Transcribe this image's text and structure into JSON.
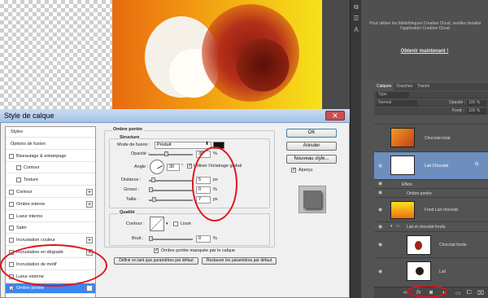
{
  "colors": {
    "accent_red": "#e0141e",
    "selection": "#3d86f0",
    "layer_selected": "#6d8fbf",
    "shadow_swatch": "#111111"
  },
  "cc": {
    "message": "Pour utiliser les bibliothèques Creative Cloud, veuillez installer l'application Creative Cloud.",
    "link": "Obtenir maintenant !"
  },
  "panel": {
    "tabs": [
      "Calques",
      "Couches",
      "Tracés"
    ],
    "filter": "Type",
    "blend": "Normal",
    "opacity_label": "Opacité :",
    "opacity": "100 %",
    "fill_label": "Fond :",
    "fill": "100 %",
    "layers": [
      {
        "name": "Chocolat éclat"
      },
      {
        "name": "Lait Chocolat",
        "fx": "fx"
      },
      {
        "name": "Effets"
      },
      {
        "name": "Ombre portée"
      },
      {
        "name": "Fond Lait chocolat"
      },
      {
        "name": "Lait et chocolat fondu"
      },
      {
        "name": "Chocolat fondu"
      },
      {
        "name": "Lait"
      }
    ],
    "bottom_icons": [
      "link-icon",
      "fx-icon",
      "mask-icon",
      "adjustment-icon",
      "folder-icon",
      "new-layer-icon",
      "trash-icon"
    ]
  },
  "dialog": {
    "title": "Style de calque",
    "close": "✕",
    "styles_list": [
      {
        "label": "Styles",
        "checkbox": false
      },
      {
        "label": "Options de fusion",
        "checkbox": false
      },
      {
        "label": "Biseautage & estampage",
        "checkbox": true,
        "checked": false
      },
      {
        "label": "Contour",
        "checkbox": true,
        "checked": false,
        "sub": true
      },
      {
        "label": "Texture",
        "checkbox": true,
        "checked": false,
        "sub": true
      },
      {
        "label": "Contour",
        "checkbox": true,
        "checked": false,
        "plus": true
      },
      {
        "label": "Ombre interne",
        "checkbox": true,
        "checked": false,
        "plus": true
      },
      {
        "label": "Lueur interne",
        "checkbox": true,
        "checked": false
      },
      {
        "label": "Satin",
        "checkbox": true,
        "checked": false
      },
      {
        "label": "Incrustation couleur",
        "checkbox": true,
        "checked": false,
        "plus": true
      },
      {
        "label": "Incrustation en dégradé",
        "checkbox": true,
        "checked": false,
        "plus": true
      },
      {
        "label": "Incrustation de motif",
        "checkbox": true,
        "checked": false
      },
      {
        "label": "Lueur externe",
        "checkbox": true,
        "checked": false
      },
      {
        "label": "Ombre portée",
        "checkbox": true,
        "checked": true,
        "plus": true,
        "selected": true
      }
    ],
    "drop_shadow": {
      "title": "Ombre portée",
      "structure": "Structure",
      "blend_mode_label": "Mode de fusion :",
      "blend_mode": "Produit",
      "opacity_label": "Opacité :",
      "opacity": "35",
      "opacity_unit": "%",
      "angle_label": "Angle :",
      "angle": "30",
      "global_light": "Utiliser l'éclairage global",
      "distance_label": "Distance :",
      "distance": "5",
      "spread_label": "Grossi :",
      "spread": "0",
      "size_label": "Taille :",
      "size": "7",
      "px": "px",
      "pct": "%",
      "quality": "Qualité",
      "contour_label": "Contour :",
      "antialias": "Lissé",
      "noise_label": "Bruit :",
      "noise": "0",
      "knockout": "Ombre portée masquée par le calque",
      "make_default": "Définir en tant que paramètres par défaut",
      "reset_default": "Restaurer les paramètres par défaut"
    },
    "buttons": {
      "ok": "OK",
      "cancel": "Annuler",
      "new_style": "Nouveau style...",
      "preview": "Aperçu"
    }
  }
}
